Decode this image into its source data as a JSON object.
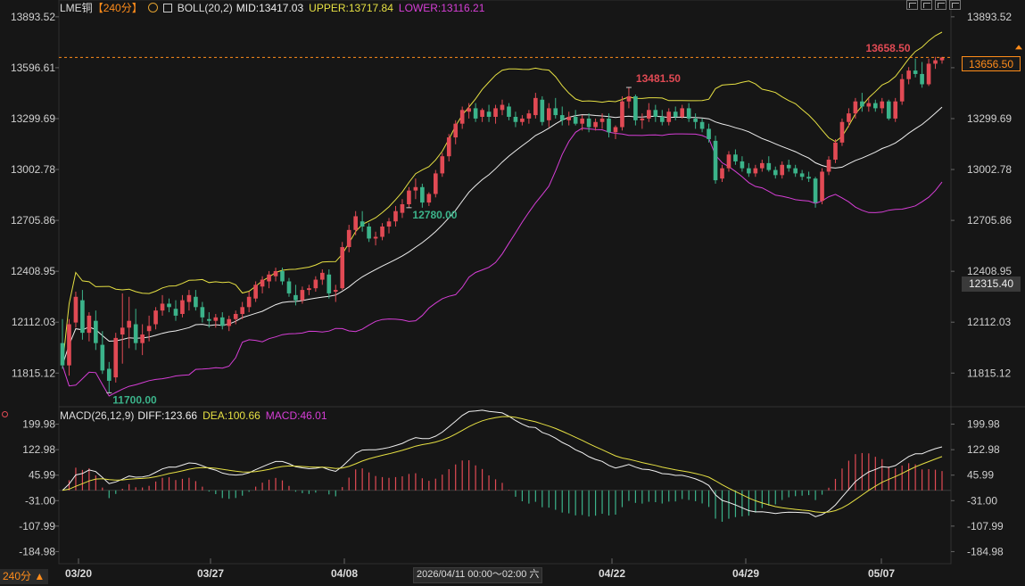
{
  "header": {
    "symbol": "LME铜",
    "period": "【240分】",
    "boll": "BOLL(20,2)",
    "mid": "MID:13417.03",
    "upper": "UPPER:13717.84",
    "lower": "LOWER:13116.21",
    "macd_params": "MACD(26,12,9)",
    "diff": "DIFF:123.66",
    "dea": "DEA:100.66",
    "macd": "MACD:46.01"
  },
  "axis": {
    "price_ticks": [
      "13893.52",
      "13596.61",
      "13299.69",
      "13002.78",
      "12705.86",
      "12408.95",
      "12112.03",
      "11815.12"
    ],
    "macd_ticks": [
      "199.98",
      "122.98",
      "45.99",
      "-31.00",
      "-107.99",
      "-184.98"
    ],
    "x_ticks": [
      "03/20",
      "03/27",
      "04/08",
      "04/22",
      "04/29",
      "05/07"
    ],
    "current_price": "13656.50",
    "cross_price": "12315.40",
    "cross_date": "2026/04/11 00:00～02:00 六",
    "period_label": "240分 ▲"
  },
  "annotations": {
    "low1": "11700.00",
    "high1": "13481.50",
    "low2": "12780.00",
    "high2": "13658.50"
  },
  "colors": {
    "up": "#e14a54",
    "down": "#3bb38a",
    "upper": "#e6e043",
    "mid": "#eeeeee",
    "lower": "#d63ed6",
    "dea": "#e6e043",
    "accent": "#ff8c1a"
  },
  "chart_data": {
    "type": "candlestick",
    "price_range": [
      11650,
      13950
    ],
    "macd_range": [
      -200,
      215
    ],
    "candles_ohlc": [
      [
        11990,
        12130,
        11840,
        11860
      ],
      [
        11860,
        12130,
        11800,
        12100
      ],
      [
        12110,
        12290,
        12080,
        12260
      ],
      [
        12240,
        12300,
        12010,
        12050
      ],
      [
        12050,
        12170,
        12000,
        12150
      ],
      [
        12120,
        12180,
        11950,
        11990
      ],
      [
        11980,
        12060,
        11810,
        11830
      ],
      [
        11840,
        11880,
        11700,
        11770
      ],
      [
        11790,
        12050,
        11760,
        12020
      ],
      [
        12040,
        12280,
        11870,
        12080
      ],
      [
        12080,
        12260,
        11960,
        12120
      ],
      [
        12100,
        12190,
        11950,
        11990
      ],
      [
        11990,
        12100,
        11920,
        12040
      ],
      [
        12060,
        12150,
        12000,
        12090
      ],
      [
        12100,
        12200,
        12070,
        12180
      ],
      [
        12180,
        12270,
        12150,
        12220
      ],
      [
        12220,
        12250,
        12170,
        12200
      ],
      [
        12190,
        12240,
        12120,
        12150
      ],
      [
        12160,
        12270,
        12140,
        12240
      ],
      [
        12230,
        12300,
        12180,
        12270
      ],
      [
        12260,
        12300,
        12180,
        12200
      ],
      [
        12200,
        12230,
        12110,
        12140
      ],
      [
        12130,
        12170,
        12080,
        12120
      ],
      [
        12120,
        12160,
        12080,
        12140
      ],
      [
        12140,
        12170,
        12070,
        12090
      ],
      [
        12090,
        12150,
        12060,
        12130
      ],
      [
        12130,
        12180,
        12100,
        12160
      ],
      [
        12160,
        12230,
        12130,
        12200
      ],
      [
        12200,
        12290,
        12170,
        12260
      ],
      [
        12250,
        12350,
        12230,
        12330
      ],
      [
        12320,
        12380,
        12280,
        12360
      ],
      [
        12350,
        12410,
        12310,
        12390
      ],
      [
        12380,
        12430,
        12350,
        12410
      ],
      [
        12410,
        12430,
        12330,
        12350
      ],
      [
        12350,
        12370,
        12260,
        12280
      ],
      [
        12270,
        12330,
        12210,
        12240
      ],
      [
        12240,
        12320,
        12220,
        12300
      ],
      [
        12300,
        12330,
        12270,
        12310
      ],
      [
        12310,
        12380,
        12290,
        12360
      ],
      [
        12360,
        12420,
        12330,
        12400
      ],
      [
        12390,
        12420,
        12250,
        12280
      ],
      [
        12290,
        12330,
        12230,
        12300
      ],
      [
        12310,
        12580,
        12300,
        12550
      ],
      [
        12550,
        12680,
        12520,
        12650
      ],
      [
        12650,
        12760,
        12620,
        12730
      ],
      [
        12700,
        12760,
        12640,
        12670
      ],
      [
        12670,
        12690,
        12580,
        12600
      ],
      [
        12600,
        12640,
        12560,
        12610
      ],
      [
        12610,
        12690,
        12590,
        12670
      ],
      [
        12670,
        12720,
        12630,
        12700
      ],
      [
        12700,
        12790,
        12670,
        12760
      ],
      [
        12750,
        12830,
        12720,
        12800
      ],
      [
        12800,
        12900,
        12780,
        12880
      ],
      [
        12880,
        12950,
        12830,
        12900
      ],
      [
        12900,
        12920,
        12780,
        12810
      ],
      [
        12810,
        12870,
        12790,
        12860
      ],
      [
        12860,
        13000,
        12840,
        12980
      ],
      [
        12980,
        13100,
        12960,
        13080
      ],
      [
        13080,
        13210,
        13050,
        13190
      ],
      [
        13190,
        13290,
        13150,
        13270
      ],
      [
        13270,
        13370,
        13240,
        13350
      ],
      [
        13340,
        13390,
        13300,
        13360
      ],
      [
        13360,
        13390,
        13280,
        13300
      ],
      [
        13310,
        13360,
        13280,
        13350
      ],
      [
        13340,
        13380,
        13280,
        13310
      ],
      [
        13310,
        13380,
        13270,
        13360
      ],
      [
        13350,
        13410,
        13320,
        13380
      ],
      [
        13370,
        13390,
        13290,
        13310
      ],
      [
        13310,
        13340,
        13250,
        13280
      ],
      [
        13280,
        13320,
        13260,
        13300
      ],
      [
        13300,
        13350,
        13270,
        13330
      ],
      [
        13320,
        13450,
        13300,
        13420
      ],
      [
        13410,
        13430,
        13260,
        13280
      ],
      [
        13290,
        13390,
        13250,
        13360
      ],
      [
        13360,
        13420,
        13300,
        13320
      ],
      [
        13320,
        13370,
        13260,
        13290
      ],
      [
        13290,
        13340,
        13260,
        13310
      ],
      [
        13310,
        13350,
        13260,
        13270
      ],
      [
        13270,
        13320,
        13230,
        13300
      ],
      [
        13300,
        13330,
        13220,
        13250
      ],
      [
        13250,
        13300,
        13230,
        13280
      ],
      [
        13280,
        13330,
        13240,
        13300
      ],
      [
        13300,
        13330,
        13190,
        13220
      ],
      [
        13220,
        13260,
        13180,
        13250
      ],
      [
        13250,
        13430,
        13230,
        13400
      ],
      [
        13400,
        13480,
        13360,
        13430
      ],
      [
        13430,
        13440,
        13260,
        13290
      ],
      [
        13290,
        13330,
        13240,
        13300
      ],
      [
        13300,
        13390,
        13280,
        13350
      ],
      [
        13350,
        13380,
        13280,
        13310
      ],
      [
        13310,
        13350,
        13260,
        13280
      ],
      [
        13280,
        13360,
        13260,
        13340
      ],
      [
        13340,
        13370,
        13290,
        13310
      ],
      [
        13310,
        13380,
        13300,
        13360
      ],
      [
        13360,
        13390,
        13280,
        13300
      ],
      [
        13300,
        13330,
        13240,
        13280
      ],
      [
        13280,
        13300,
        13220,
        13240
      ],
      [
        13240,
        13270,
        13160,
        13180
      ],
      [
        13170,
        13200,
        12920,
        12940
      ],
      [
        12950,
        13030,
        12930,
        13010
      ],
      [
        13010,
        13110,
        12990,
        13090
      ],
      [
        13090,
        13120,
        13030,
        13050
      ],
      [
        13050,
        13080,
        12990,
        13010
      ],
      [
        13010,
        13040,
        12960,
        12980
      ],
      [
        12980,
        13030,
        12960,
        13010
      ],
      [
        13010,
        13060,
        12990,
        13040
      ],
      [
        13040,
        13080,
        12990,
        13000
      ],
      [
        13000,
        13020,
        12950,
        12970
      ],
      [
        12970,
        13050,
        12950,
        13030
      ],
      [
        13030,
        13060,
        12990,
        13010
      ],
      [
        13010,
        13030,
        12960,
        12980
      ],
      [
        12980,
        13000,
        12940,
        12960
      ],
      [
        12960,
        12990,
        12930,
        12950
      ],
      [
        12950,
        12960,
        12780,
        12810
      ],
      [
        12820,
        13010,
        12800,
        12990
      ],
      [
        12990,
        13080,
        12970,
        13060
      ],
      [
        13060,
        13180,
        13040,
        13160
      ],
      [
        13160,
        13300,
        13140,
        13280
      ],
      [
        13280,
        13360,
        13250,
        13330
      ],
      [
        13330,
        13420,
        13300,
        13400
      ],
      [
        13400,
        13450,
        13340,
        13370
      ],
      [
        13370,
        13420,
        13340,
        13390
      ],
      [
        13390,
        13410,
        13340,
        13360
      ],
      [
        13360,
        13420,
        13330,
        13400
      ],
      [
        13400,
        13410,
        13290,
        13300
      ],
      [
        13300,
        13420,
        13280,
        13400
      ],
      [
        13400,
        13560,
        13380,
        13530
      ],
      [
        13530,
        13600,
        13500,
        13580
      ],
      [
        13580,
        13650,
        13540,
        13560
      ],
      [
        13560,
        13630,
        13480,
        13500
      ],
      [
        13500,
        13650,
        13490,
        13620
      ],
      [
        13620,
        13660,
        13590,
        13640
      ],
      [
        13640,
        13660,
        13620,
        13656.5
      ]
    ]
  }
}
